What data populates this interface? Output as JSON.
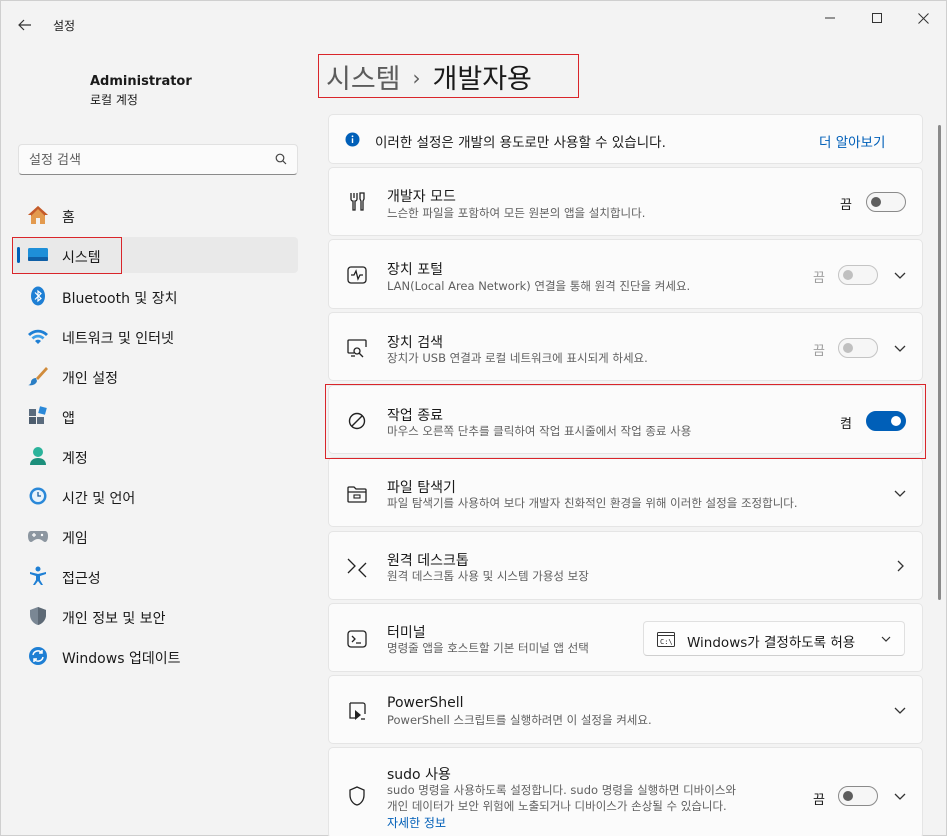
{
  "window": {
    "app_title": "설정"
  },
  "profile": {
    "name": "Administrator",
    "account_type": "로컬 계정"
  },
  "search": {
    "placeholder": "설정 검색"
  },
  "sidebar": {
    "items": [
      {
        "label": "홈",
        "icon": "home-icon"
      },
      {
        "label": "시스템",
        "icon": "system-icon",
        "active": true
      },
      {
        "label": "Bluetooth 및 장치",
        "icon": "bluetooth-icon"
      },
      {
        "label": "네트워크 및 인터넷",
        "icon": "wifi-icon"
      },
      {
        "label": "개인 설정",
        "icon": "brush-icon"
      },
      {
        "label": "앱",
        "icon": "apps-icon"
      },
      {
        "label": "계정",
        "icon": "account-icon"
      },
      {
        "label": "시간 및 언어",
        "icon": "time-language-icon"
      },
      {
        "label": "게임",
        "icon": "gamepad-icon"
      },
      {
        "label": "접근성",
        "icon": "accessibility-icon"
      },
      {
        "label": "개인 정보 및 보안",
        "icon": "shield-icon"
      },
      {
        "label": "Windows 업데이트",
        "icon": "update-icon"
      }
    ]
  },
  "breadcrumb": {
    "parent": "시스템",
    "separator": "›",
    "current": "개발자용"
  },
  "info_banner": {
    "text": "이러한 설정은 개발의 용도로만 사용할 수 있습니다.",
    "link": "더 알아보기"
  },
  "settings": {
    "developer_mode": {
      "title": "개발자 모드",
      "desc": "느슨한 파일을 포함하여 모든 원본의 앱을 설치합니다.",
      "state": "끔"
    },
    "device_portal": {
      "title": "장치 포털",
      "desc": "LAN(Local Area Network) 연결을 통해 원격 진단을 켜세요.",
      "state": "끔"
    },
    "device_discovery": {
      "title": "장치 검색",
      "desc": "장치가 USB 연결과 로컬 네트워크에 표시되게 하세요.",
      "state": "끔"
    },
    "end_task": {
      "title": "작업 종료",
      "desc": "마우스 오른쪽 단추를 클릭하여 작업 표시줄에서 작업 종료 사용",
      "state": "켬"
    },
    "file_explorer": {
      "title": "파일 탐색기",
      "desc": "파일 탐색기를 사용하여 보다 개발자 친화적인 환경을 위해 이러한 설정을 조정합니다."
    },
    "remote_desktop": {
      "title": "원격 데스크톱",
      "desc": "원격 데스크톱 사용 및 시스템 가용성 보장"
    },
    "terminal": {
      "title": "터미널",
      "desc": "명령줄 앱을 호스트할 기본 터미널 앱 선택",
      "dropdown_value": "Windows가 결정하도록 허용"
    },
    "powershell": {
      "title": "PowerShell",
      "desc": "PowerShell 스크립트를 실행하려면 이 설정을 켜세요."
    },
    "sudo": {
      "title": "sudo 사용",
      "desc_line1": "sudo 명령을 사용하도록 설정합니다. sudo 명령을 실행하면 디바이스와",
      "desc_line2": "개인 데이터가 보안 위험에 노출되거나 디바이스가 손상될 수 있습니다.",
      "link": "자세한 정보",
      "state": "끔"
    }
  },
  "colors": {
    "accent": "#005fb8",
    "highlight": "#d9252a"
  }
}
